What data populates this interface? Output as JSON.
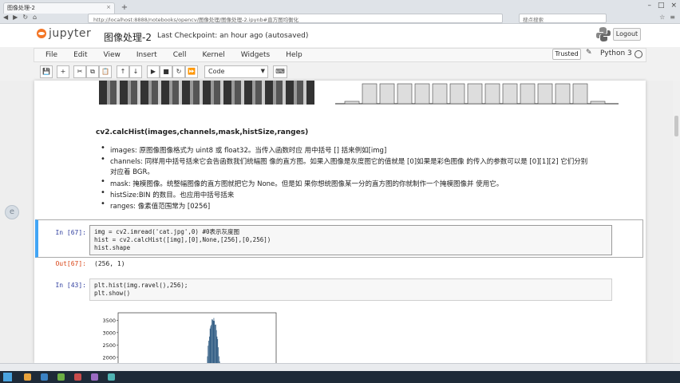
{
  "browser": {
    "tab_title": "图像处理-2",
    "address": "http://localhost:8888/notebooks/opencv/图像处理/图像处理-2.ipynb#直方图均衡化",
    "search_placeholder": "搜点搜索"
  },
  "header": {
    "logo_text": "jupyter",
    "notebook_title": "图像处理-2",
    "checkpoint": "Last Checkpoint: an hour ago (autosaved)",
    "logout_label": "Logout"
  },
  "menubar": {
    "items": [
      "File",
      "Edit",
      "View",
      "Insert",
      "Cell",
      "Kernel",
      "Widgets",
      "Help"
    ],
    "trusted_label": "Trusted",
    "kernel_name": "Python 3"
  },
  "toolbar": {
    "cell_type": "Code"
  },
  "markdown": {
    "title": "cv2.calcHist(images,channels,mask,histSize,ranges)",
    "bullets": [
      "images: 原图像图像格式为 uint8 或 float32。当传入函数时应 用中括号 [] 括来例如[img]",
      "channels: 同样用中括号括来它会告函数我们统幅图 像的直方图。如果入图像是灰度图它的值就是 [0]如果是彩色图像 的传入的参数可以是 [0][1][2] 它们分别",
      "对应着 BGR。",
      "mask: 掩模图像。统整幅图像的直方图就把它为 None。但是如 果你想统图像某一分的直方图的你就制作一个掩模图像并 使用它。",
      "histSize:BIN 的数目。也应用中括号括来",
      "ranges: 像素值范围常为 [0256]"
    ]
  },
  "cells": [
    {
      "prompt": "In [67]:",
      "lines": [
        "img = cv2.imread('cat.jpg',0) #0表示灰度图",
        "hist = cv2.calcHist([img],[0],None,[256],[0,256])",
        "hist.shape"
      ],
      "out_prompt": "Out[67]:",
      "output": "(256, 1)"
    },
    {
      "prompt": "In [43]:",
      "lines": [
        "plt.hist(img.ravel(),256);",
        "plt.show()"
      ]
    }
  ],
  "chart_data": {
    "type": "bar",
    "ytick_labels": [
      "3500",
      "3000",
      "2500",
      "2000"
    ],
    "ylim": [
      1800,
      3800
    ]
  },
  "taskbar": {
    "clock": ""
  }
}
